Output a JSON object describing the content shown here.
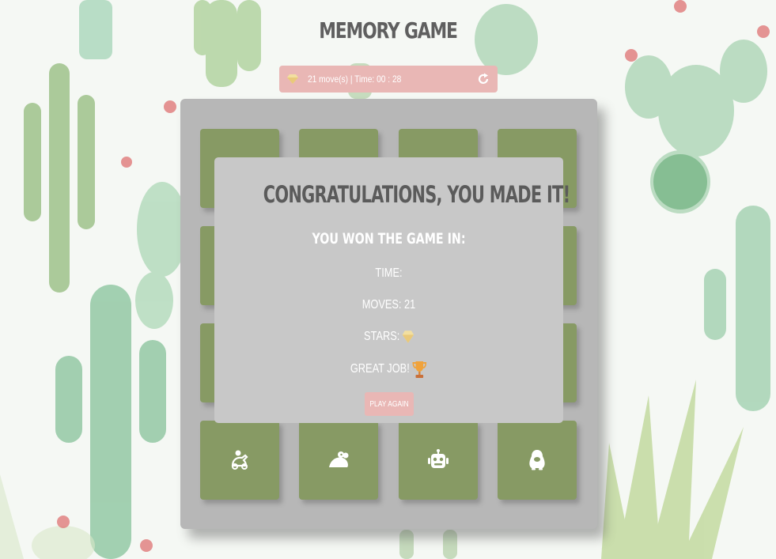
{
  "game": {
    "title": "MEMORY GAME",
    "score_text": "21 move(s) | Time: 00 : 28",
    "star_icon": "gem-icon",
    "restart_icon": "restart-icon"
  },
  "cards": [
    {
      "icon": "hidden"
    },
    {
      "icon": "hidden"
    },
    {
      "icon": "hidden"
    },
    {
      "icon": "hidden"
    },
    {
      "icon": "hidden"
    },
    {
      "icon": "hidden"
    },
    {
      "icon": "hidden"
    },
    {
      "icon": "hidden"
    },
    {
      "icon": "hidden"
    },
    {
      "icon": "hidden"
    },
    {
      "icon": "hidden"
    },
    {
      "icon": "hidden"
    },
    {
      "icon": "rider-icon"
    },
    {
      "icon": "frog-icon"
    },
    {
      "icon": "robot-icon"
    },
    {
      "icon": "penguin-icon"
    }
  ],
  "modal": {
    "heading": "CONGRATULATIONS, YOU MADE IT!",
    "subheading": "YOU WON THE GAME IN:",
    "time_label": "TIME:",
    "moves_label": "MOVES: 21",
    "stars_label": "STARS:",
    "great_job": "GREAT JOB!",
    "trophy_icon": "trophy-icon",
    "play_again": "PLAY AGAIN"
  },
  "colors": {
    "card": "#879a64",
    "deck": "#b7b7b7",
    "accent_pink": "#e9b7b5",
    "modal": "#c8c8c8"
  }
}
